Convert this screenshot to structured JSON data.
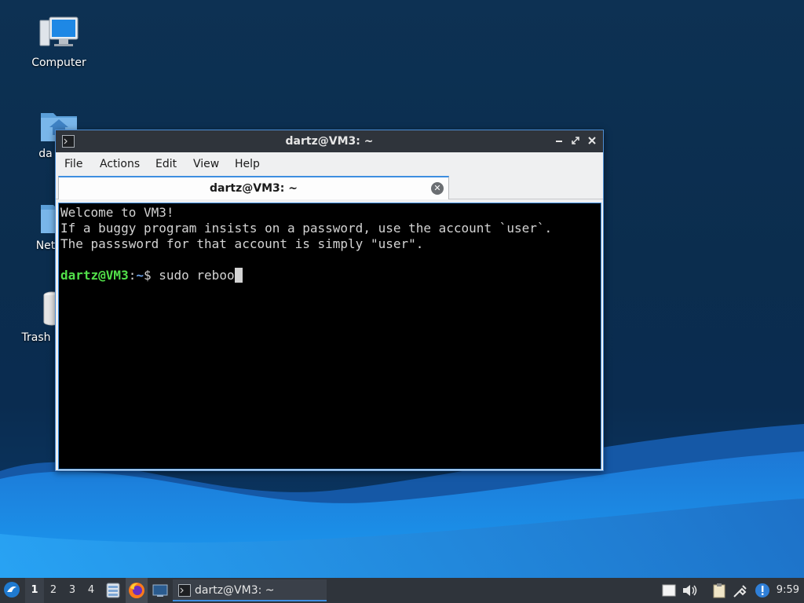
{
  "desktop": {
    "icons": [
      {
        "label": "Computer",
        "icon": "computer-icon"
      },
      {
        "label": "da",
        "icon": "home-folder-icon"
      },
      {
        "label": "Net",
        "icon": "network-icon"
      },
      {
        "label": "Trash",
        "icon": "trash-icon"
      }
    ]
  },
  "window": {
    "title": "dartz@VM3: ~",
    "menu": [
      "File",
      "Actions",
      "Edit",
      "View",
      "Help"
    ],
    "tab_title": "dartz@VM3: ~",
    "terminal": {
      "lines": [
        "Welcome to VM3!",
        "If a buggy program insists on a password, use the account `user`.",
        "The passsword for that account is simply \"user\"."
      ],
      "prompt_user": "dartz@VM3",
      "prompt_sep": ":",
      "prompt_path": "~",
      "prompt_symbol": "$ ",
      "command": "sudo reboo"
    }
  },
  "taskbar": {
    "workspaces": [
      "1",
      "2",
      "3",
      "4"
    ],
    "active_workspace": "1",
    "task_label": "dartz@VM3: ~",
    "clock": "9:59"
  },
  "colors": {
    "accent": "#3d8ee0",
    "prompt_user": "#52e04a",
    "prompt_path": "#6ba0e6",
    "panel": "#2f343b"
  }
}
